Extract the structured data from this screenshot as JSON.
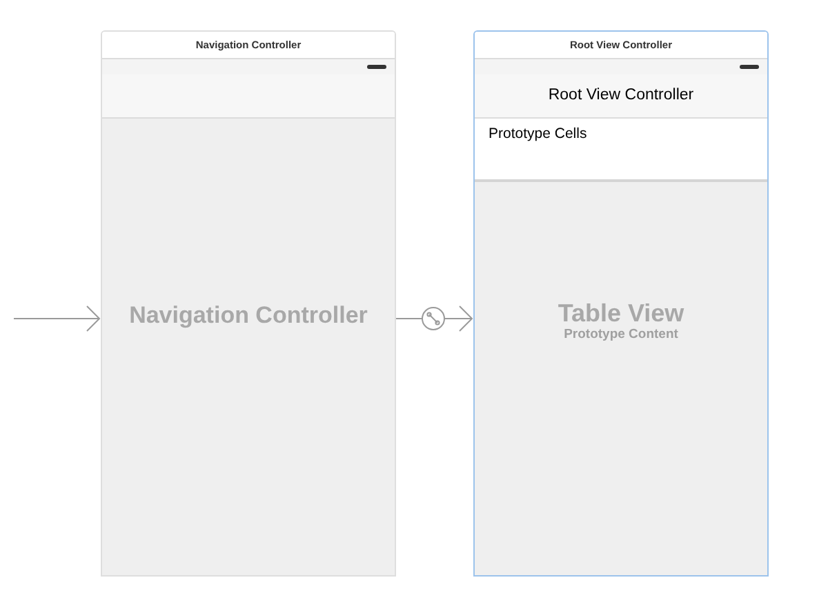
{
  "scenes": [
    {
      "kind": "navigation",
      "title": "Navigation Controller",
      "selected": false,
      "placeholder": "Navigation Controller"
    },
    {
      "kind": "table",
      "title": "Root View Controller",
      "selected": true,
      "nav_title": "Root View Controller",
      "section_label": "Prototype Cells",
      "placeholder": "Table View",
      "placeholder_subtitle": "Prototype Content"
    }
  ]
}
